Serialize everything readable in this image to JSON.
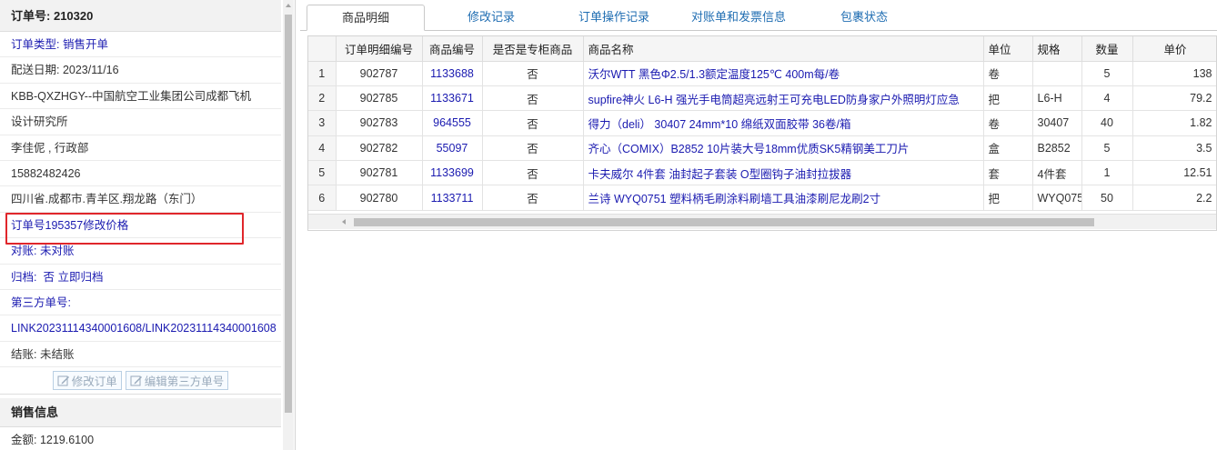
{
  "order": {
    "header_label": "订单号:",
    "header_number": "210320",
    "type_label": "订单类型:",
    "type_value": "销售开单",
    "delivery_date": "配送日期:  2023/11/16",
    "company_line1": "KBB-QXZHGY--中国航空工业集团公司成都飞机",
    "company_line2": "设计研究所",
    "contact": "李佳伲 , 行政部",
    "phone": "15882482426",
    "address": "四川省.成都市.青羊区.翔龙路（东门）",
    "price_change_note": "订单号195357修改价格",
    "reconcile_label": "对账:",
    "reconcile_value": "未对账",
    "archive_label": "归档:",
    "archive_value": "否",
    "archive_link": "立即归档",
    "third_party_label": "第三方单号:",
    "third_party_value": "LINK20231114340001608/LINK20231114340001608",
    "settlement": "结账:  未结账",
    "btn_modify": "修改订单",
    "btn_edit_third": "编辑第三方单号"
  },
  "sales_info": {
    "header": "销售信息",
    "amount": "金额:  1219.6100"
  },
  "tabs": [
    "商品明细",
    "修改记录",
    "订单操作记录",
    "对账单和发票信息",
    "包裹状态"
  ],
  "grid": {
    "columns": [
      "订单明细编号",
      "商品编号",
      "是否是专柜商品",
      "商品名称",
      "单位",
      "规格",
      "数量",
      "单价"
    ],
    "rows": [
      {
        "n": "1",
        "detail_id": "902787",
        "sku": "1133688",
        "counter": "否",
        "name": "沃尔WTT 黑色Φ2.5/1.3额定温度125℃ 400m每/卷",
        "unit": "卷",
        "spec": "",
        "qty": "5",
        "price": "138"
      },
      {
        "n": "2",
        "detail_id": "902785",
        "sku": "1133671",
        "counter": "否",
        "name": "supfire神火 L6-H 强光手电筒超亮远射王可充电LED防身家户外照明灯应急",
        "unit": "把",
        "spec": "L6-H",
        "qty": "4",
        "price": "79.2"
      },
      {
        "n": "3",
        "detail_id": "902783",
        "sku": "964555",
        "counter": "否",
        "name": "得力（deli） 30407 24mm*10 绵纸双面胶带 36卷/箱",
        "unit": "卷",
        "spec": "30407",
        "qty": "40",
        "price": "1.82"
      },
      {
        "n": "4",
        "detail_id": "902782",
        "sku": "55097",
        "counter": "否",
        "name": "齐心（COMIX）B2852 10片装大号18mm优质SK5精钢美工刀片",
        "unit": "盒",
        "spec": "B2852",
        "qty": "5",
        "price": "3.5"
      },
      {
        "n": "5",
        "detail_id": "902781",
        "sku": "1133699",
        "counter": "否",
        "name": "卡夫威尔 4件套 油封起子套装 O型圈钩子油封拉拔器",
        "unit": "套",
        "spec": "4件套",
        "qty": "1",
        "price": "12.51"
      },
      {
        "n": "6",
        "detail_id": "902780",
        "sku": "1133711",
        "counter": "否",
        "name": "兰诗 WYQ0751 塑料柄毛刷涂料刷墙工具油漆刷尼龙刷2寸",
        "unit": "把",
        "spec": "WYQ0751",
        "qty": "50",
        "price": "2.2"
      }
    ]
  },
  "colors": {
    "link": "#1a1ab0",
    "highlight": "#e0262b",
    "tab_link": "#1f6db2"
  }
}
